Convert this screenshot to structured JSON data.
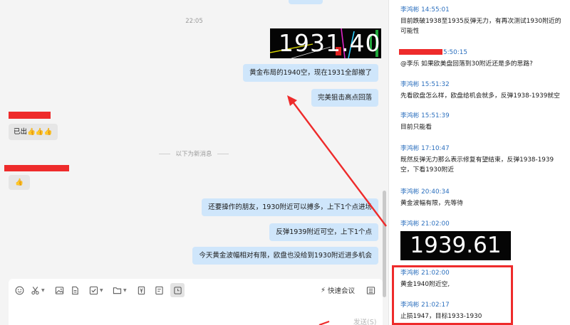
{
  "chat": {
    "time_separator": "22:05",
    "image1_price": "1931.40",
    "sent_1": "黄金布局的1940空，现在1931全部撤了",
    "sent_2": "完美狙击高点回落",
    "reply_1_text": "已出",
    "reply_1_emoji": "👍👍👍",
    "new_messages": "以下为新消息",
    "reply_2_emoji": "👍",
    "sent_3": "还要操作的朋友，1930附近可以搏多，上下1个点进场",
    "sent_4": "反弹1939附近可空，上下1个点",
    "sent_5": "今天黄金波幅相对有限，欧盘也没给到1930附近进多机会"
  },
  "composer": {
    "quick_meeting_label": "快速会议",
    "send_label": "发送(S)"
  },
  "panel": {
    "messages": [
      {
        "sender": "李鸿彬 14:55:01",
        "text": "目前跌破1938至1935反弹无力，有再次测试1930附近的可能性"
      },
      {
        "sender": "5:50:15",
        "text": "@李乐   如果欧美盘回落到30附近还是多的思路?"
      },
      {
        "sender": "李鸿彬 15:51:32",
        "text": "先看欧盘怎么样，欧盘给机会就多，反弹1938-1939就空"
      },
      {
        "sender": "李鸿彬 15:51:39",
        "text": "目前只能看"
      },
      {
        "sender": "李鸿彬 17:10:47",
        "text": "既然反弹无力那么表示修复有望结束，反弹1938-1939空，下看1930附近"
      },
      {
        "sender": "李鸿彬 20:40:34",
        "text": "黄金波幅有限，先等待"
      },
      {
        "sender": "李鸿彬 21:02:00",
        "text": ""
      },
      {
        "sender": "李鸿彬 21:02:00",
        "text": "黄金1940附近空,"
      },
      {
        "sender": "李鸿彬 21:02:17",
        "text": "止损1947，目标1933-1930"
      }
    ],
    "image2_price": "1939.61"
  },
  "colors": {
    "accent_blue": "#2b6fbe",
    "bubble_blue": "#cfe6fb",
    "annotation_red": "#ee2b2b"
  }
}
